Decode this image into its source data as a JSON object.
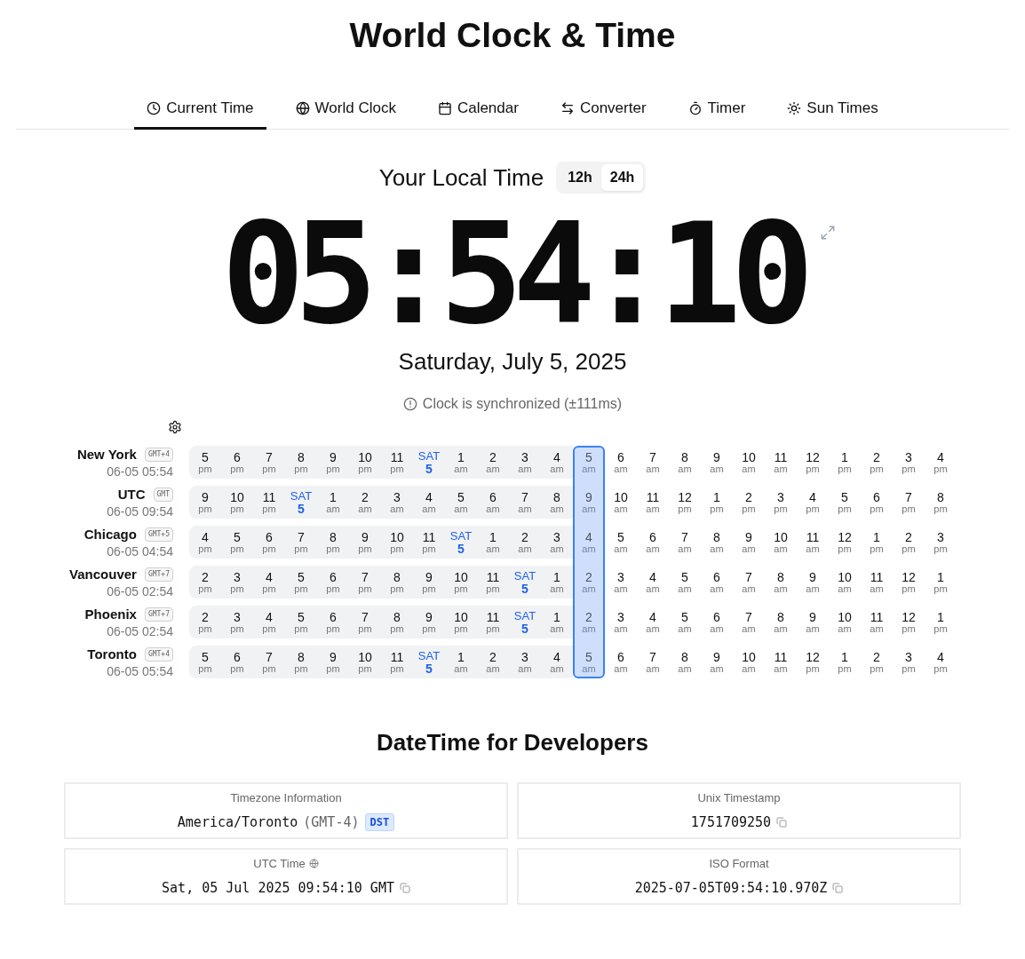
{
  "title": "World Clock & Time",
  "tabs": [
    {
      "label": "Current Time",
      "selected": true
    },
    {
      "label": "World Clock",
      "selected": false
    },
    {
      "label": "Calendar",
      "selected": false
    },
    {
      "label": "Converter",
      "selected": false
    },
    {
      "label": "Timer",
      "selected": false
    },
    {
      "label": "Sun Times",
      "selected": false
    }
  ],
  "local_time": {
    "heading": "Your Local Time",
    "format_toggle": [
      {
        "label": "12h",
        "selected": false
      },
      {
        "label": "24h",
        "selected": true
      }
    ],
    "time": "05:54:10",
    "date": "Saturday, July 5, 2025",
    "sync_status": "Clock is synchronized (±111ms)"
  },
  "timeline": [
    {
      "city": "New York",
      "offset": "GMT+4",
      "datetime": "06-05 05:54",
      "hours": [
        {
          "kind": "hour",
          "hour": "5",
          "period": "pm",
          "selected": false
        },
        {
          "kind": "hour",
          "hour": "6",
          "period": "pm",
          "selected": false
        },
        {
          "kind": "hour",
          "hour": "7",
          "period": "pm",
          "selected": false
        },
        {
          "kind": "hour",
          "hour": "8",
          "period": "pm",
          "selected": false
        },
        {
          "kind": "hour",
          "hour": "9",
          "period": "pm",
          "selected": false
        },
        {
          "kind": "hour",
          "hour": "10",
          "period": "pm",
          "selected": false
        },
        {
          "kind": "hour",
          "hour": "11",
          "period": "pm",
          "selected": false
        },
        {
          "kind": "day",
          "day": "SAT",
          "date": "5",
          "selected": false
        },
        {
          "kind": "hour",
          "hour": "1",
          "period": "am",
          "selected": false
        },
        {
          "kind": "hour",
          "hour": "2",
          "period": "am",
          "selected": false
        },
        {
          "kind": "hour",
          "hour": "3",
          "period": "am",
          "selected": false
        },
        {
          "kind": "hour",
          "hour": "4",
          "period": "am",
          "selected": false
        },
        {
          "kind": "hour",
          "hour": "5",
          "period": "am",
          "selected": true
        },
        {
          "kind": "hour",
          "hour": "6",
          "period": "am",
          "selected": false
        },
        {
          "kind": "hour",
          "hour": "7",
          "period": "am",
          "selected": false
        },
        {
          "kind": "hour",
          "hour": "8",
          "period": "am",
          "selected": false
        },
        {
          "kind": "hour",
          "hour": "9",
          "period": "am",
          "selected": false
        },
        {
          "kind": "hour",
          "hour": "10",
          "period": "am",
          "selected": false
        },
        {
          "kind": "hour",
          "hour": "11",
          "period": "am",
          "selected": false
        },
        {
          "kind": "hour",
          "hour": "12",
          "period": "pm",
          "selected": false
        },
        {
          "kind": "hour",
          "hour": "1",
          "period": "pm",
          "selected": false
        },
        {
          "kind": "hour",
          "hour": "2",
          "period": "pm",
          "selected": false
        },
        {
          "kind": "hour",
          "hour": "3",
          "period": "pm",
          "selected": false
        },
        {
          "kind": "hour",
          "hour": "4",
          "period": "pm",
          "selected": false
        }
      ]
    },
    {
      "city": "UTC",
      "offset": "GMT",
      "datetime": "06-05 09:54",
      "hours": [
        {
          "kind": "hour",
          "hour": "9",
          "period": "pm",
          "selected": false
        },
        {
          "kind": "hour",
          "hour": "10",
          "period": "pm",
          "selected": false
        },
        {
          "kind": "hour",
          "hour": "11",
          "period": "pm",
          "selected": false
        },
        {
          "kind": "day",
          "day": "SAT",
          "date": "5",
          "selected": false
        },
        {
          "kind": "hour",
          "hour": "1",
          "period": "am",
          "selected": false
        },
        {
          "kind": "hour",
          "hour": "2",
          "period": "am",
          "selected": false
        },
        {
          "kind": "hour",
          "hour": "3",
          "period": "am",
          "selected": false
        },
        {
          "kind": "hour",
          "hour": "4",
          "period": "am",
          "selected": false
        },
        {
          "kind": "hour",
          "hour": "5",
          "period": "am",
          "selected": false
        },
        {
          "kind": "hour",
          "hour": "6",
          "period": "am",
          "selected": false
        },
        {
          "kind": "hour",
          "hour": "7",
          "period": "am",
          "selected": false
        },
        {
          "kind": "hour",
          "hour": "8",
          "period": "am",
          "selected": false
        },
        {
          "kind": "hour",
          "hour": "9",
          "period": "am",
          "selected": true
        },
        {
          "kind": "hour",
          "hour": "10",
          "period": "am",
          "selected": false
        },
        {
          "kind": "hour",
          "hour": "11",
          "period": "am",
          "selected": false
        },
        {
          "kind": "hour",
          "hour": "12",
          "period": "pm",
          "selected": false
        },
        {
          "kind": "hour",
          "hour": "1",
          "period": "pm",
          "selected": false
        },
        {
          "kind": "hour",
          "hour": "2",
          "period": "pm",
          "selected": false
        },
        {
          "kind": "hour",
          "hour": "3",
          "period": "pm",
          "selected": false
        },
        {
          "kind": "hour",
          "hour": "4",
          "period": "pm",
          "selected": false
        },
        {
          "kind": "hour",
          "hour": "5",
          "period": "pm",
          "selected": false
        },
        {
          "kind": "hour",
          "hour": "6",
          "period": "pm",
          "selected": false
        },
        {
          "kind": "hour",
          "hour": "7",
          "period": "pm",
          "selected": false
        },
        {
          "kind": "hour",
          "hour": "8",
          "period": "pm",
          "selected": false
        }
      ]
    },
    {
      "city": "Chicago",
      "offset": "GMT+5",
      "datetime": "06-05 04:54",
      "hours": [
        {
          "kind": "hour",
          "hour": "4",
          "period": "pm",
          "selected": false
        },
        {
          "kind": "hour",
          "hour": "5",
          "period": "pm",
          "selected": false
        },
        {
          "kind": "hour",
          "hour": "6",
          "period": "pm",
          "selected": false
        },
        {
          "kind": "hour",
          "hour": "7",
          "period": "pm",
          "selected": false
        },
        {
          "kind": "hour",
          "hour": "8",
          "period": "pm",
          "selected": false
        },
        {
          "kind": "hour",
          "hour": "9",
          "period": "pm",
          "selected": false
        },
        {
          "kind": "hour",
          "hour": "10",
          "period": "pm",
          "selected": false
        },
        {
          "kind": "hour",
          "hour": "11",
          "period": "pm",
          "selected": false
        },
        {
          "kind": "day",
          "day": "SAT",
          "date": "5",
          "selected": false
        },
        {
          "kind": "hour",
          "hour": "1",
          "period": "am",
          "selected": false
        },
        {
          "kind": "hour",
          "hour": "2",
          "period": "am",
          "selected": false
        },
        {
          "kind": "hour",
          "hour": "3",
          "period": "am",
          "selected": false
        },
        {
          "kind": "hour",
          "hour": "4",
          "period": "am",
          "selected": true
        },
        {
          "kind": "hour",
          "hour": "5",
          "period": "am",
          "selected": false
        },
        {
          "kind": "hour",
          "hour": "6",
          "period": "am",
          "selected": false
        },
        {
          "kind": "hour",
          "hour": "7",
          "period": "am",
          "selected": false
        },
        {
          "kind": "hour",
          "hour": "8",
          "period": "am",
          "selected": false
        },
        {
          "kind": "hour",
          "hour": "9",
          "period": "am",
          "selected": false
        },
        {
          "kind": "hour",
          "hour": "10",
          "period": "am",
          "selected": false
        },
        {
          "kind": "hour",
          "hour": "11",
          "period": "am",
          "selected": false
        },
        {
          "kind": "hour",
          "hour": "12",
          "period": "pm",
          "selected": false
        },
        {
          "kind": "hour",
          "hour": "1",
          "period": "pm",
          "selected": false
        },
        {
          "kind": "hour",
          "hour": "2",
          "period": "pm",
          "selected": false
        },
        {
          "kind": "hour",
          "hour": "3",
          "period": "pm",
          "selected": false
        }
      ]
    },
    {
      "city": "Vancouver",
      "offset": "GMT+7",
      "datetime": "06-05 02:54",
      "hours": [
        {
          "kind": "hour",
          "hour": "2",
          "period": "pm",
          "selected": false
        },
        {
          "kind": "hour",
          "hour": "3",
          "period": "pm",
          "selected": false
        },
        {
          "kind": "hour",
          "hour": "4",
          "period": "pm",
          "selected": false
        },
        {
          "kind": "hour",
          "hour": "5",
          "period": "pm",
          "selected": false
        },
        {
          "kind": "hour",
          "hour": "6",
          "period": "pm",
          "selected": false
        },
        {
          "kind": "hour",
          "hour": "7",
          "period": "pm",
          "selected": false
        },
        {
          "kind": "hour",
          "hour": "8",
          "period": "pm",
          "selected": false
        },
        {
          "kind": "hour",
          "hour": "9",
          "period": "pm",
          "selected": false
        },
        {
          "kind": "hour",
          "hour": "10",
          "period": "pm",
          "selected": false
        },
        {
          "kind": "hour",
          "hour": "11",
          "period": "pm",
          "selected": false
        },
        {
          "kind": "day",
          "day": "SAT",
          "date": "5",
          "selected": false
        },
        {
          "kind": "hour",
          "hour": "1",
          "period": "am",
          "selected": false
        },
        {
          "kind": "hour",
          "hour": "2",
          "period": "am",
          "selected": true
        },
        {
          "kind": "hour",
          "hour": "3",
          "period": "am",
          "selected": false
        },
        {
          "kind": "hour",
          "hour": "4",
          "period": "am",
          "selected": false
        },
        {
          "kind": "hour",
          "hour": "5",
          "period": "am",
          "selected": false
        },
        {
          "kind": "hour",
          "hour": "6",
          "period": "am",
          "selected": false
        },
        {
          "kind": "hour",
          "hour": "7",
          "period": "am",
          "selected": false
        },
        {
          "kind": "hour",
          "hour": "8",
          "period": "am",
          "selected": false
        },
        {
          "kind": "hour",
          "hour": "9",
          "period": "am",
          "selected": false
        },
        {
          "kind": "hour",
          "hour": "10",
          "period": "am",
          "selected": false
        },
        {
          "kind": "hour",
          "hour": "11",
          "period": "am",
          "selected": false
        },
        {
          "kind": "hour",
          "hour": "12",
          "period": "pm",
          "selected": false
        },
        {
          "kind": "hour",
          "hour": "1",
          "period": "pm",
          "selected": false
        }
      ]
    },
    {
      "city": "Phoenix",
      "offset": "GMT+7",
      "datetime": "06-05 02:54",
      "hours": [
        {
          "kind": "hour",
          "hour": "2",
          "period": "pm",
          "selected": false
        },
        {
          "kind": "hour",
          "hour": "3",
          "period": "pm",
          "selected": false
        },
        {
          "kind": "hour",
          "hour": "4",
          "period": "pm",
          "selected": false
        },
        {
          "kind": "hour",
          "hour": "5",
          "period": "pm",
          "selected": false
        },
        {
          "kind": "hour",
          "hour": "6",
          "period": "pm",
          "selected": false
        },
        {
          "kind": "hour",
          "hour": "7",
          "period": "pm",
          "selected": false
        },
        {
          "kind": "hour",
          "hour": "8",
          "period": "pm",
          "selected": false
        },
        {
          "kind": "hour",
          "hour": "9",
          "period": "pm",
          "selected": false
        },
        {
          "kind": "hour",
          "hour": "10",
          "period": "pm",
          "selected": false
        },
        {
          "kind": "hour",
          "hour": "11",
          "period": "pm",
          "selected": false
        },
        {
          "kind": "day",
          "day": "SAT",
          "date": "5",
          "selected": false
        },
        {
          "kind": "hour",
          "hour": "1",
          "period": "am",
          "selected": false
        },
        {
          "kind": "hour",
          "hour": "2",
          "period": "am",
          "selected": true
        },
        {
          "kind": "hour",
          "hour": "3",
          "period": "am",
          "selected": false
        },
        {
          "kind": "hour",
          "hour": "4",
          "period": "am",
          "selected": false
        },
        {
          "kind": "hour",
          "hour": "5",
          "period": "am",
          "selected": false
        },
        {
          "kind": "hour",
          "hour": "6",
          "period": "am",
          "selected": false
        },
        {
          "kind": "hour",
          "hour": "7",
          "period": "am",
          "selected": false
        },
        {
          "kind": "hour",
          "hour": "8",
          "period": "am",
          "selected": false
        },
        {
          "kind": "hour",
          "hour": "9",
          "period": "am",
          "selected": false
        },
        {
          "kind": "hour",
          "hour": "10",
          "period": "am",
          "selected": false
        },
        {
          "kind": "hour",
          "hour": "11",
          "period": "am",
          "selected": false
        },
        {
          "kind": "hour",
          "hour": "12",
          "period": "pm",
          "selected": false
        },
        {
          "kind": "hour",
          "hour": "1",
          "period": "pm",
          "selected": false
        }
      ]
    },
    {
      "city": "Toronto",
      "offset": "GMT+4",
      "datetime": "06-05 05:54",
      "hours": [
        {
          "kind": "hour",
          "hour": "5",
          "period": "pm",
          "selected": false
        },
        {
          "kind": "hour",
          "hour": "6",
          "period": "pm",
          "selected": false
        },
        {
          "kind": "hour",
          "hour": "7",
          "period": "pm",
          "selected": false
        },
        {
          "kind": "hour",
          "hour": "8",
          "period": "pm",
          "selected": false
        },
        {
          "kind": "hour",
          "hour": "9",
          "period": "pm",
          "selected": false
        },
        {
          "kind": "hour",
          "hour": "10",
          "period": "pm",
          "selected": false
        },
        {
          "kind": "hour",
          "hour": "11",
          "period": "pm",
          "selected": false
        },
        {
          "kind": "day",
          "day": "SAT",
          "date": "5",
          "selected": false
        },
        {
          "kind": "hour",
          "hour": "1",
          "period": "am",
          "selected": false
        },
        {
          "kind": "hour",
          "hour": "2",
          "period": "am",
          "selected": false
        },
        {
          "kind": "hour",
          "hour": "3",
          "period": "am",
          "selected": false
        },
        {
          "kind": "hour",
          "hour": "4",
          "period": "am",
          "selected": false
        },
        {
          "kind": "hour",
          "hour": "5",
          "period": "am",
          "selected": true
        },
        {
          "kind": "hour",
          "hour": "6",
          "period": "am",
          "selected": false
        },
        {
          "kind": "hour",
          "hour": "7",
          "period": "am",
          "selected": false
        },
        {
          "kind": "hour",
          "hour": "8",
          "period": "am",
          "selected": false
        },
        {
          "kind": "hour",
          "hour": "9",
          "period": "am",
          "selected": false
        },
        {
          "kind": "hour",
          "hour": "10",
          "period": "am",
          "selected": false
        },
        {
          "kind": "hour",
          "hour": "11",
          "period": "am",
          "selected": false
        },
        {
          "kind": "hour",
          "hour": "12",
          "period": "pm",
          "selected": false
        },
        {
          "kind": "hour",
          "hour": "1",
          "period": "pm",
          "selected": false
        },
        {
          "kind": "hour",
          "hour": "2",
          "period": "pm",
          "selected": false
        },
        {
          "kind": "hour",
          "hour": "3",
          "period": "pm",
          "selected": false
        },
        {
          "kind": "hour",
          "hour": "4",
          "period": "pm",
          "selected": false
        }
      ]
    }
  ],
  "developers": {
    "heading": "DateTime for Developers",
    "cards": [
      {
        "kind": "timezone",
        "label": "Timezone Information",
        "value": "America/Toronto",
        "offset": "(GMT-4)",
        "badge": "DST"
      },
      {
        "kind": "copy",
        "label": "Unix Timestamp",
        "value": "1751709250"
      },
      {
        "kind": "utc",
        "label": "UTC Time",
        "value": "Sat, 05 Jul 2025 09:54:10 GMT"
      },
      {
        "kind": "copy",
        "label": "ISO Format",
        "value": "2025-07-05T09:54:10.970Z"
      }
    ]
  }
}
